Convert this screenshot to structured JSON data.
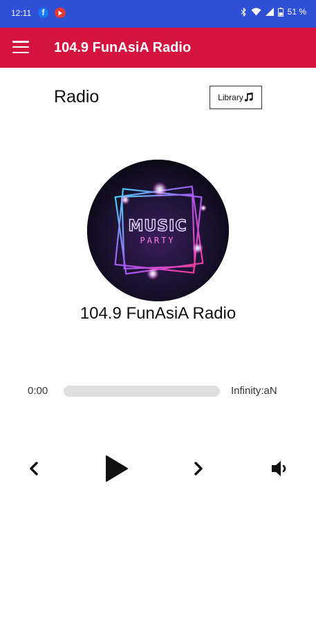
{
  "status_bar": {
    "time": "12:11",
    "notification_icons": [
      "facebook-icon",
      "youtube-icon"
    ],
    "system_icons": [
      "bluetooth-icon",
      "wifi-icon",
      "cell-signal-icon",
      "battery-icon"
    ],
    "battery": "51 %"
  },
  "app_bar": {
    "menu_icon": "hamburger-menu-icon",
    "title": "104.9 FunAsiA Radio",
    "color": "#d4143e"
  },
  "header": {
    "section_title": "Radio",
    "library_label": "Library",
    "library_icon": "music-note-icon"
  },
  "artwork": {
    "line1": "MUSIC",
    "line2": "PARTY"
  },
  "station": {
    "name": "104.9 FunAsiA Radio"
  },
  "player": {
    "current_time": "0:00",
    "duration": "Infinity:aN",
    "progress": 0,
    "controls": [
      "previous-icon",
      "play-icon",
      "next-icon",
      "volume-icon"
    ]
  },
  "colors": {
    "status_bar": "#2f4fd4",
    "accent": "#d4143e",
    "track": "#dedede"
  }
}
